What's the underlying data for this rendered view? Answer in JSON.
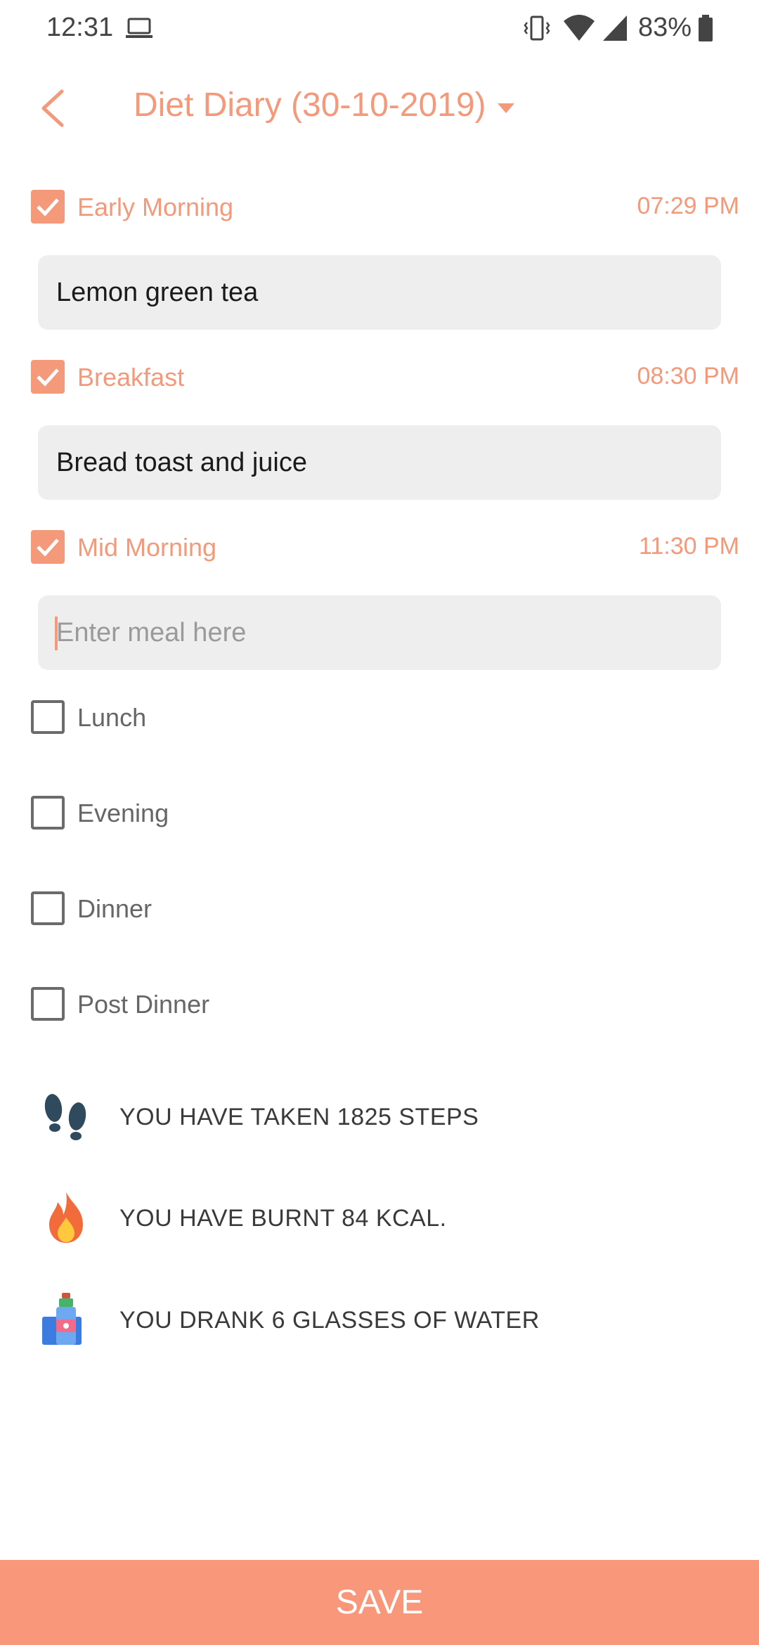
{
  "status_bar": {
    "time": "12:31",
    "battery": "83%",
    "icons": [
      "laptop-icon",
      "vibrate-icon",
      "wifi-icon",
      "signal-icon",
      "battery-icon"
    ]
  },
  "header": {
    "title": "Diet Diary (30-10-2019)",
    "back_icon": "chevron-left-icon",
    "dropdown_icon": "caret-down-icon"
  },
  "meals": [
    {
      "label": "Early Morning",
      "checked": true,
      "time": "07:29 PM",
      "entry": "Lemon green tea"
    },
    {
      "label": "Breakfast",
      "checked": true,
      "time": "08:30 PM",
      "entry": "Bread toast and juice"
    },
    {
      "label": "Mid Morning",
      "checked": true,
      "time": "11:30 PM",
      "entry": "",
      "placeholder": "Enter meal here"
    },
    {
      "label": "Lunch",
      "checked": false
    },
    {
      "label": "Evening",
      "checked": false
    },
    {
      "label": "Dinner",
      "checked": false
    },
    {
      "label": "Post Dinner",
      "checked": false
    }
  ],
  "stats": {
    "steps": "YOU HAVE TAKEN 1825 STEPS",
    "calories": "YOU HAVE BURNT 84 KCAL.",
    "water": "YOU DRANK 6 GLASSES OF WATER"
  },
  "save_label": "SAVE",
  "colors": {
    "accent": "#f4997a",
    "save_bar": "#f9977a",
    "input_bg": "#eeeeee",
    "unchecked_border": "#6b6b6b"
  }
}
